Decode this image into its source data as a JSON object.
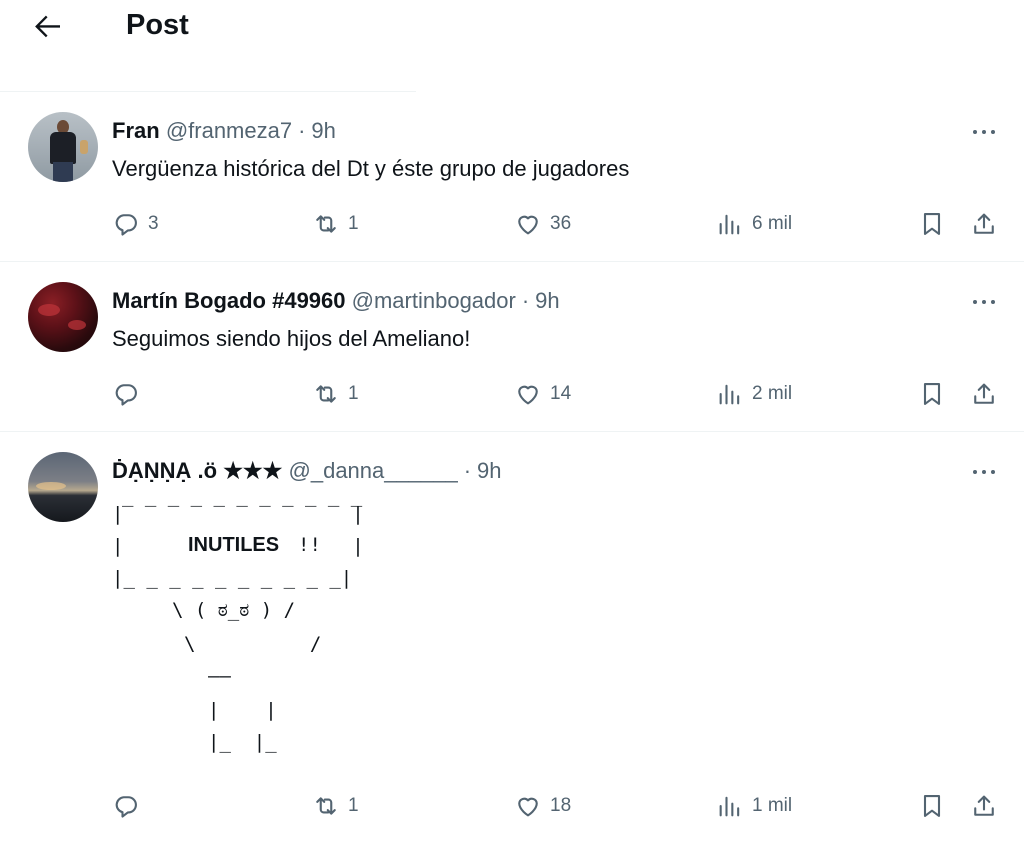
{
  "header": {
    "title": "Post"
  },
  "posts": [
    {
      "name": "Fran",
      "handle": "@franmeza7",
      "separator": "·",
      "time": "9h",
      "text": "Vergüenza histórica del Dt y éste grupo de jugadores",
      "counts": {
        "replies": "3",
        "reposts": "1",
        "likes": "36",
        "views": "6 mil"
      }
    },
    {
      "name": "Martín Bogado #49960",
      "handle": "@martinbogador",
      "separator": "·",
      "time": "9h",
      "text": "Seguimos siendo hijos del Ameliano!",
      "counts": {
        "replies": "",
        "reposts": "1",
        "likes": "14",
        "views": "2 mil"
      }
    },
    {
      "name": "ḊẠṆṆẠ .ö ★★★",
      "handle": "@_danna______",
      "separator": "·",
      "time": "9h",
      "ascii_lines": [
        "_ _ _ _ _ _ _ _ _ _ _",
        "|                    |",
        "|                    |",
        "INUTILES",
        "!!",
        "|_ _ _ _ _ _ _ _ _ _|",
        "\\ ( ಠ_ಠ ) /",
        "\\          /",
        "——",
        "|    |",
        "|_  |_"
      ],
      "counts": {
        "replies": "",
        "reposts": "1",
        "likes": "18",
        "views": "1 mil"
      }
    }
  ],
  "icons": {
    "back": "arrow-left-icon",
    "more": "more-horizontal-icon",
    "reply": "reply-icon",
    "repost": "repost-icon",
    "like": "heart-icon",
    "views": "views-icon",
    "bookmark": "bookmark-icon",
    "share": "share-icon"
  },
  "colors": {
    "text": "#0f1419",
    "muted": "#536471",
    "divider": "#eff3f4"
  }
}
